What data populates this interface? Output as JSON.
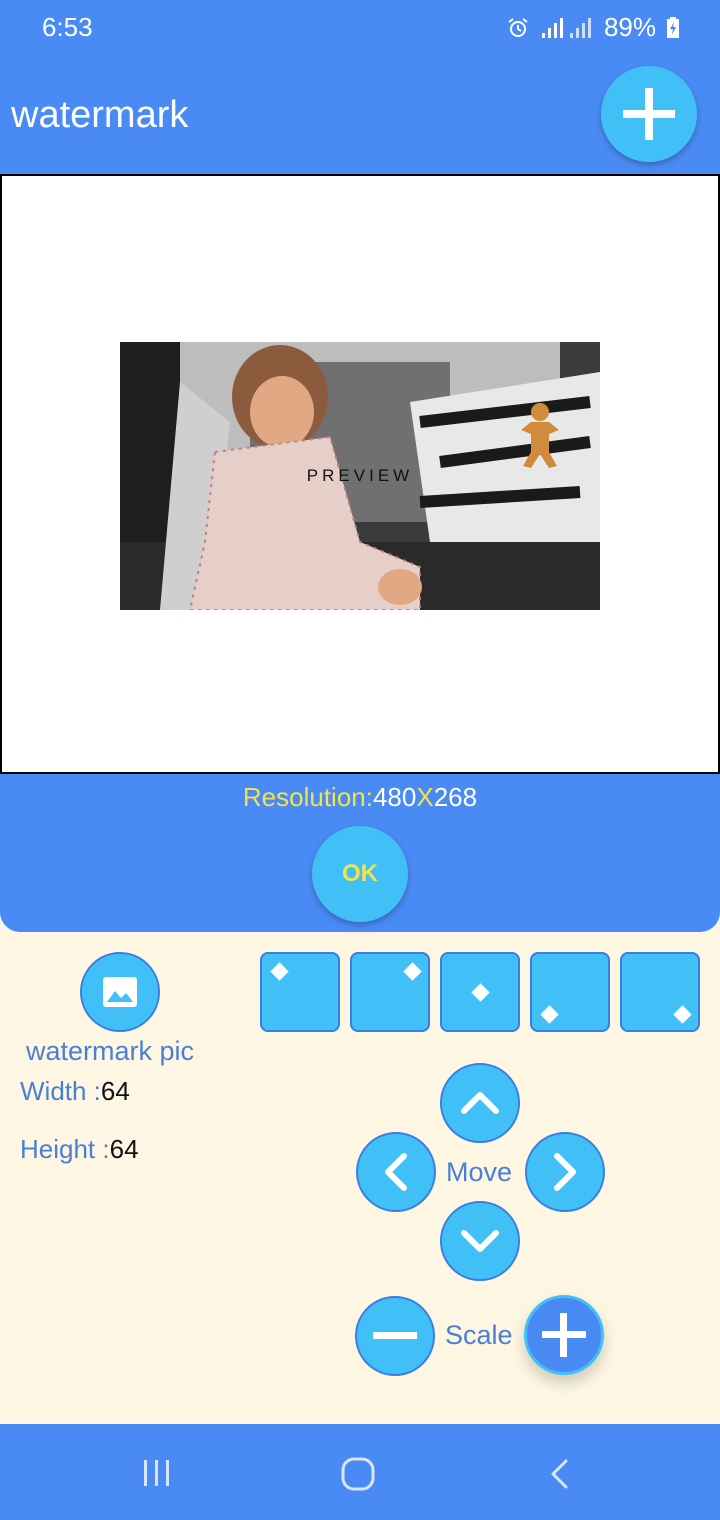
{
  "status": {
    "time": "6:53",
    "battery": "89%",
    "alarm_icon": "alarm-icon",
    "signal_icon": "signal-icon",
    "battery_icon": "battery-charging-icon"
  },
  "appbar": {
    "title": "watermark",
    "add_icon": "plus-icon"
  },
  "preview": {
    "overlay_text": "PREVIEW"
  },
  "resolution": {
    "label": "Resolution:",
    "width": "480",
    "sep": "X",
    "height": "268"
  },
  "ok_label": "OK",
  "watermark": {
    "pic_label": "watermark pic",
    "width_label": "Width :",
    "width_value": "64",
    "height_label": "Height :",
    "height_value": "64"
  },
  "positions": [
    "top-left",
    "top-right",
    "center",
    "bottom-left",
    "bottom-right"
  ],
  "move_label": "Move",
  "scale_label": "Scale",
  "colors": {
    "primary": "#4a8af4",
    "accent": "#41c0f8",
    "panel": "#fdf6e3",
    "highlight": "#f2e24c",
    "label_blue": "#4a7fd6"
  }
}
